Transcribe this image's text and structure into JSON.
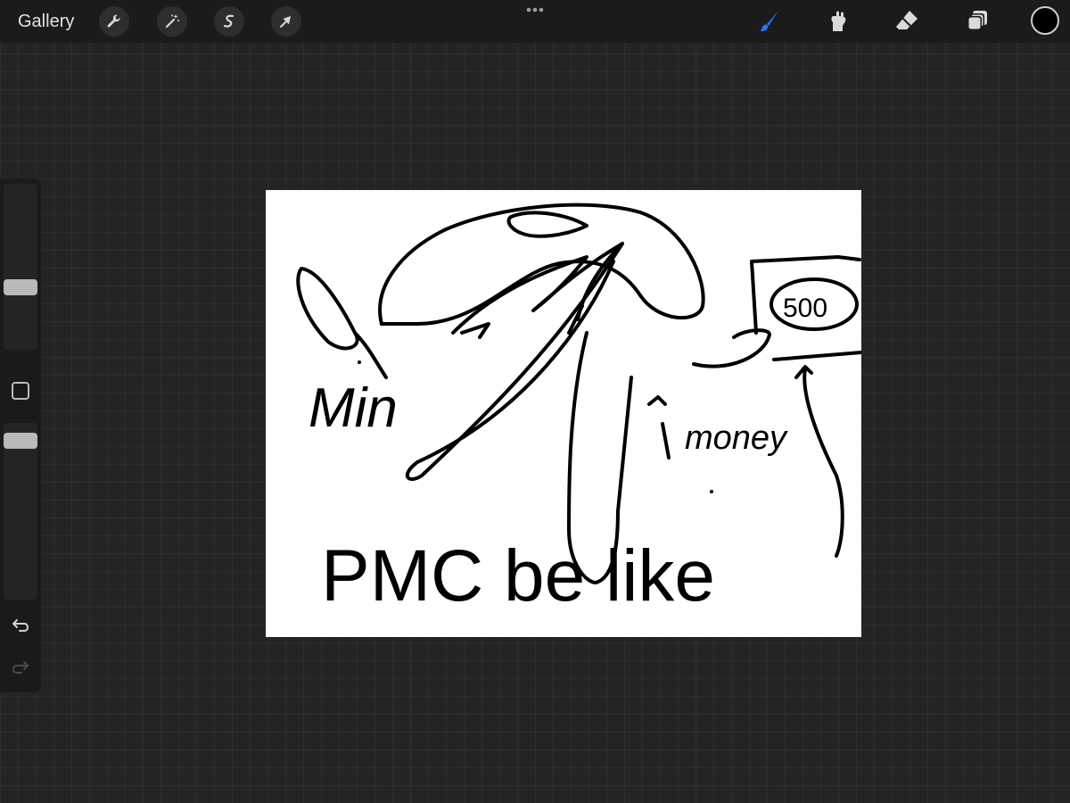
{
  "topbar": {
    "gallery_label": "Gallery",
    "left_tools": [
      "wrench-icon",
      "magic-wand-icon",
      "selection-icon",
      "transform-arrow-icon"
    ],
    "right_tools": [
      "brush-icon",
      "smudge-icon",
      "eraser-icon",
      "layers-icon"
    ],
    "active_tool": "brush-icon",
    "active_color": "#000000",
    "accent_color": "#1a7cff"
  },
  "sidebar": {
    "brush_size_slider": "slider",
    "opacity_slider": "slider",
    "modify_button": "square-icon",
    "undo": "undo-icon",
    "redo": "redo-icon"
  },
  "canvas": {
    "background": "#ffffff",
    "ink_color": "#000000",
    "handwritten_text": [
      "Min",
      "money",
      "500",
      "PMC be like"
    ]
  }
}
